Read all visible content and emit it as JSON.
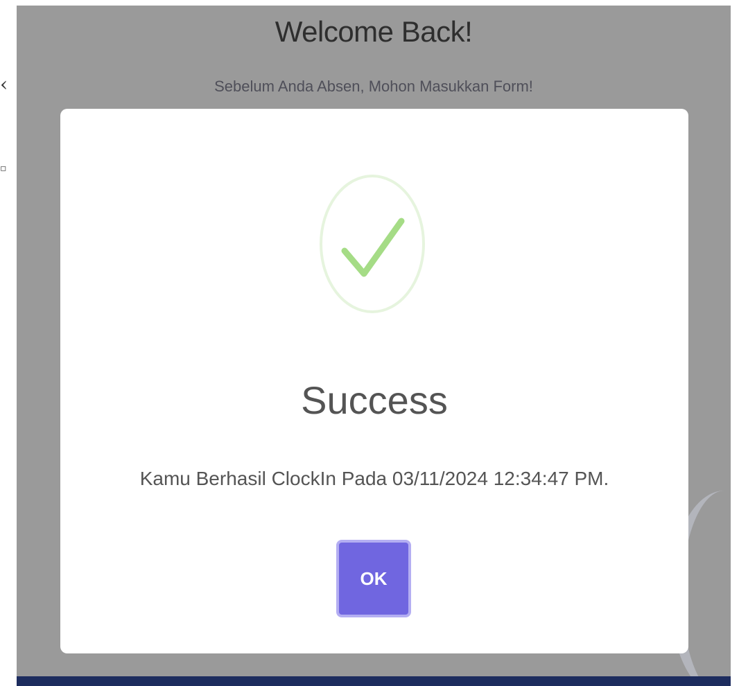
{
  "page": {
    "welcome_title": "Welcome Back!",
    "welcome_subtitle": "Sebelum Anda Absen, Mohon Masukkan Form!"
  },
  "modal": {
    "icon": "success-check-icon",
    "title": "Success",
    "message": "Kamu Berhasil ClockIn Pada 03/11/2024 12:34:47 PM.",
    "ok_label": "OK"
  },
  "colors": {
    "backdrop": "#9a9a9a",
    "modal_background": "#ffffff",
    "ok_button": "#7066e0",
    "check_green": "#a5dc86",
    "bottom_bar": "#1d2c5e"
  }
}
